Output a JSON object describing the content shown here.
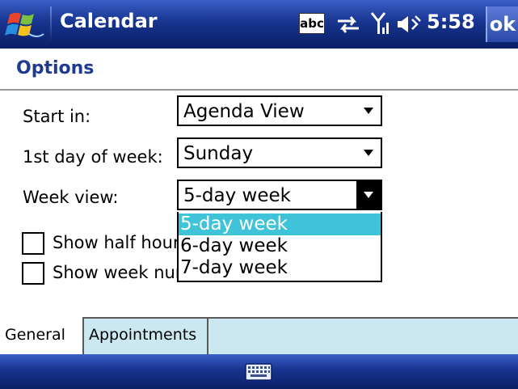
{
  "titlebar": {
    "app_title": "Calendar",
    "input_indicator": "abc",
    "time": "5:58",
    "ok_label": "ok"
  },
  "header": {
    "title": "Options"
  },
  "form": {
    "start_in": {
      "label": "Start in:",
      "value": "Agenda View"
    },
    "first_day": {
      "label": "1st day of week:",
      "value": "Sunday"
    },
    "week_view": {
      "label": "Week view:",
      "value": "5-day week",
      "options": [
        "5-day week",
        "6-day week",
        "7-day week"
      ],
      "selected_index": 0
    },
    "show_half_hour": {
      "label": "Show half hour s",
      "checked": false
    },
    "show_week_numbers": {
      "label": "Show week num",
      "checked": false
    }
  },
  "tabs": [
    {
      "label": "General",
      "active": true
    },
    {
      "label": "Appointments",
      "active": false
    }
  ],
  "colors": {
    "titlebar": "#17348f",
    "heading": "#1f3a8e",
    "selection": "#3fc3d8",
    "tabstrip": "#cbe7ef"
  },
  "icons": [
    "windows-flag-icon",
    "connectivity-icon",
    "signal-icon",
    "volume-icon",
    "keyboard-icon"
  ]
}
